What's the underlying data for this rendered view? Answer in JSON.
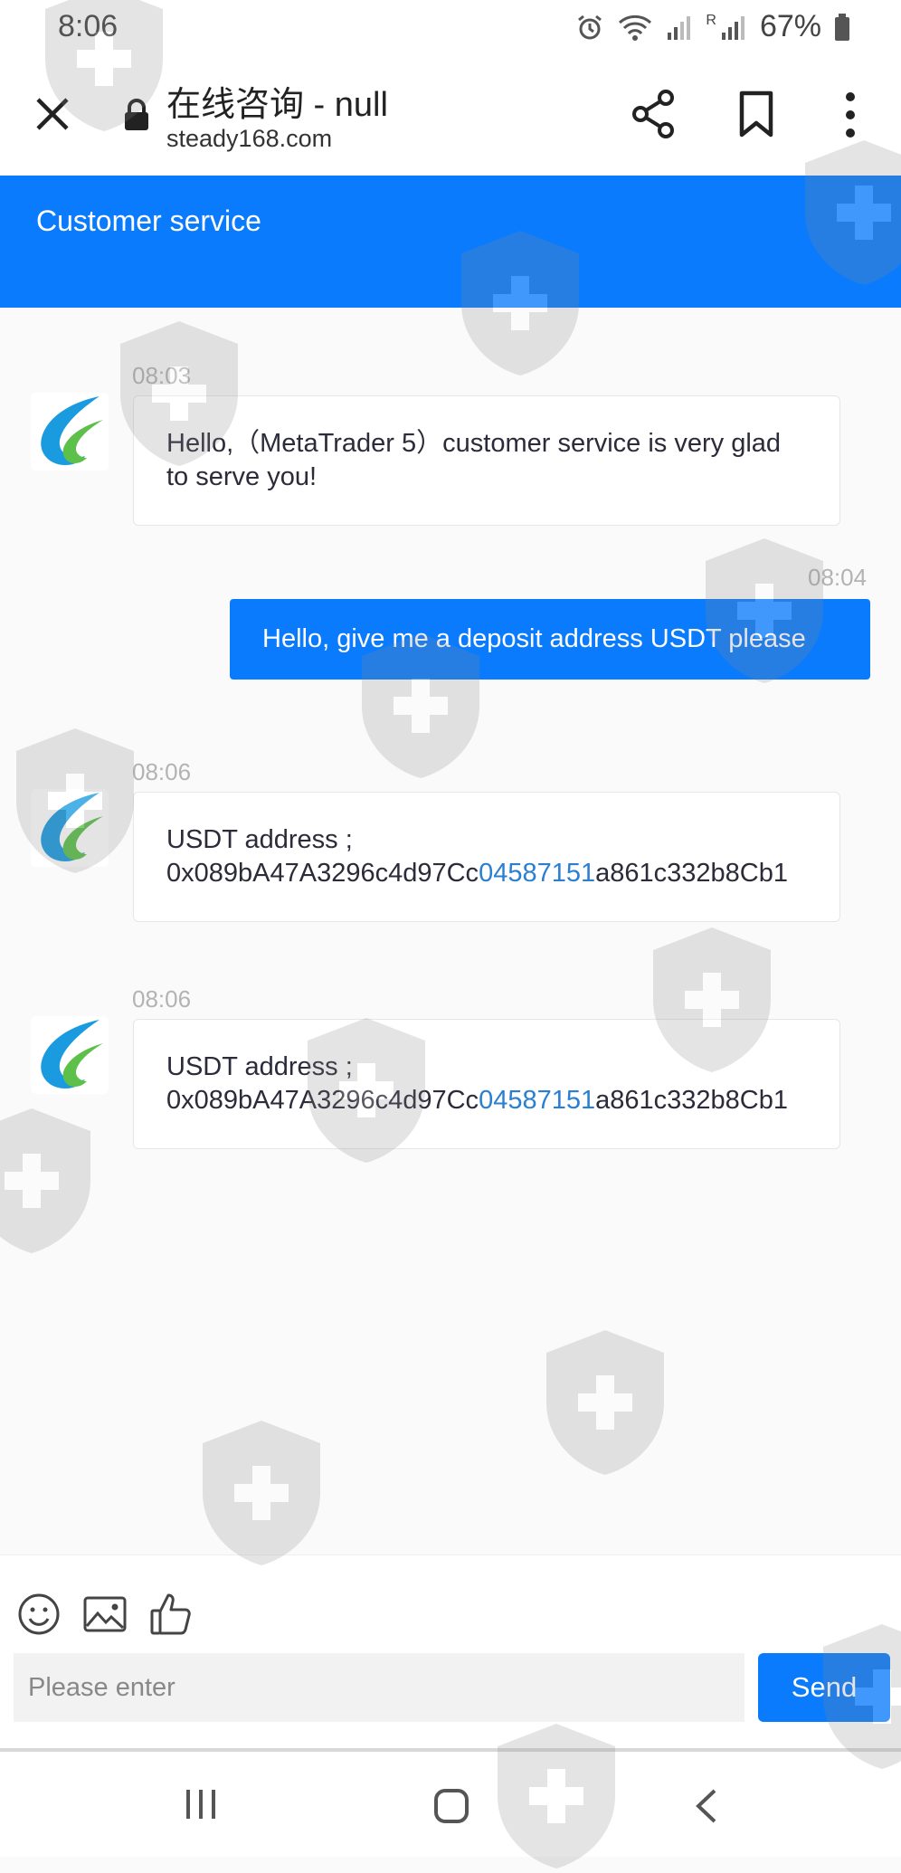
{
  "status_bar": {
    "time": "8:06",
    "battery": "67%",
    "network_roaming": "R"
  },
  "browser": {
    "title": "在线咨询 - null",
    "url": "steady168.com"
  },
  "header": {
    "title": "Customer service"
  },
  "messages": [
    {
      "time": "08:03",
      "from": "agent",
      "text": "Hello,（MetaTrader 5）customer service is very glad to serve you!"
    },
    {
      "time": "08:04",
      "from": "user",
      "text": "Hello, give me a deposit address USDT please"
    },
    {
      "time": "08:06",
      "from": "agent",
      "label": "USDT address ;",
      "addr_prefix": "0x089bA47A3296c4d97Cc",
      "addr_link": "04587151",
      "addr_suffix": "a861c332b8Cb1"
    },
    {
      "time": "08:06",
      "from": "agent",
      "label": "USDT address ;",
      "addr_prefix": "0x089bA47A3296c4d97Cc",
      "addr_link": "04587151",
      "addr_suffix": "a861c332b8Cb1"
    }
  ],
  "composer": {
    "placeholder": "Please enter",
    "send_label": "Send",
    "tools": [
      "emoji-icon",
      "image-icon",
      "thumbs-up-icon"
    ]
  },
  "colors": {
    "accent": "#0a7bfd",
    "link": "#2b7fd2",
    "background": "#fafafa"
  }
}
